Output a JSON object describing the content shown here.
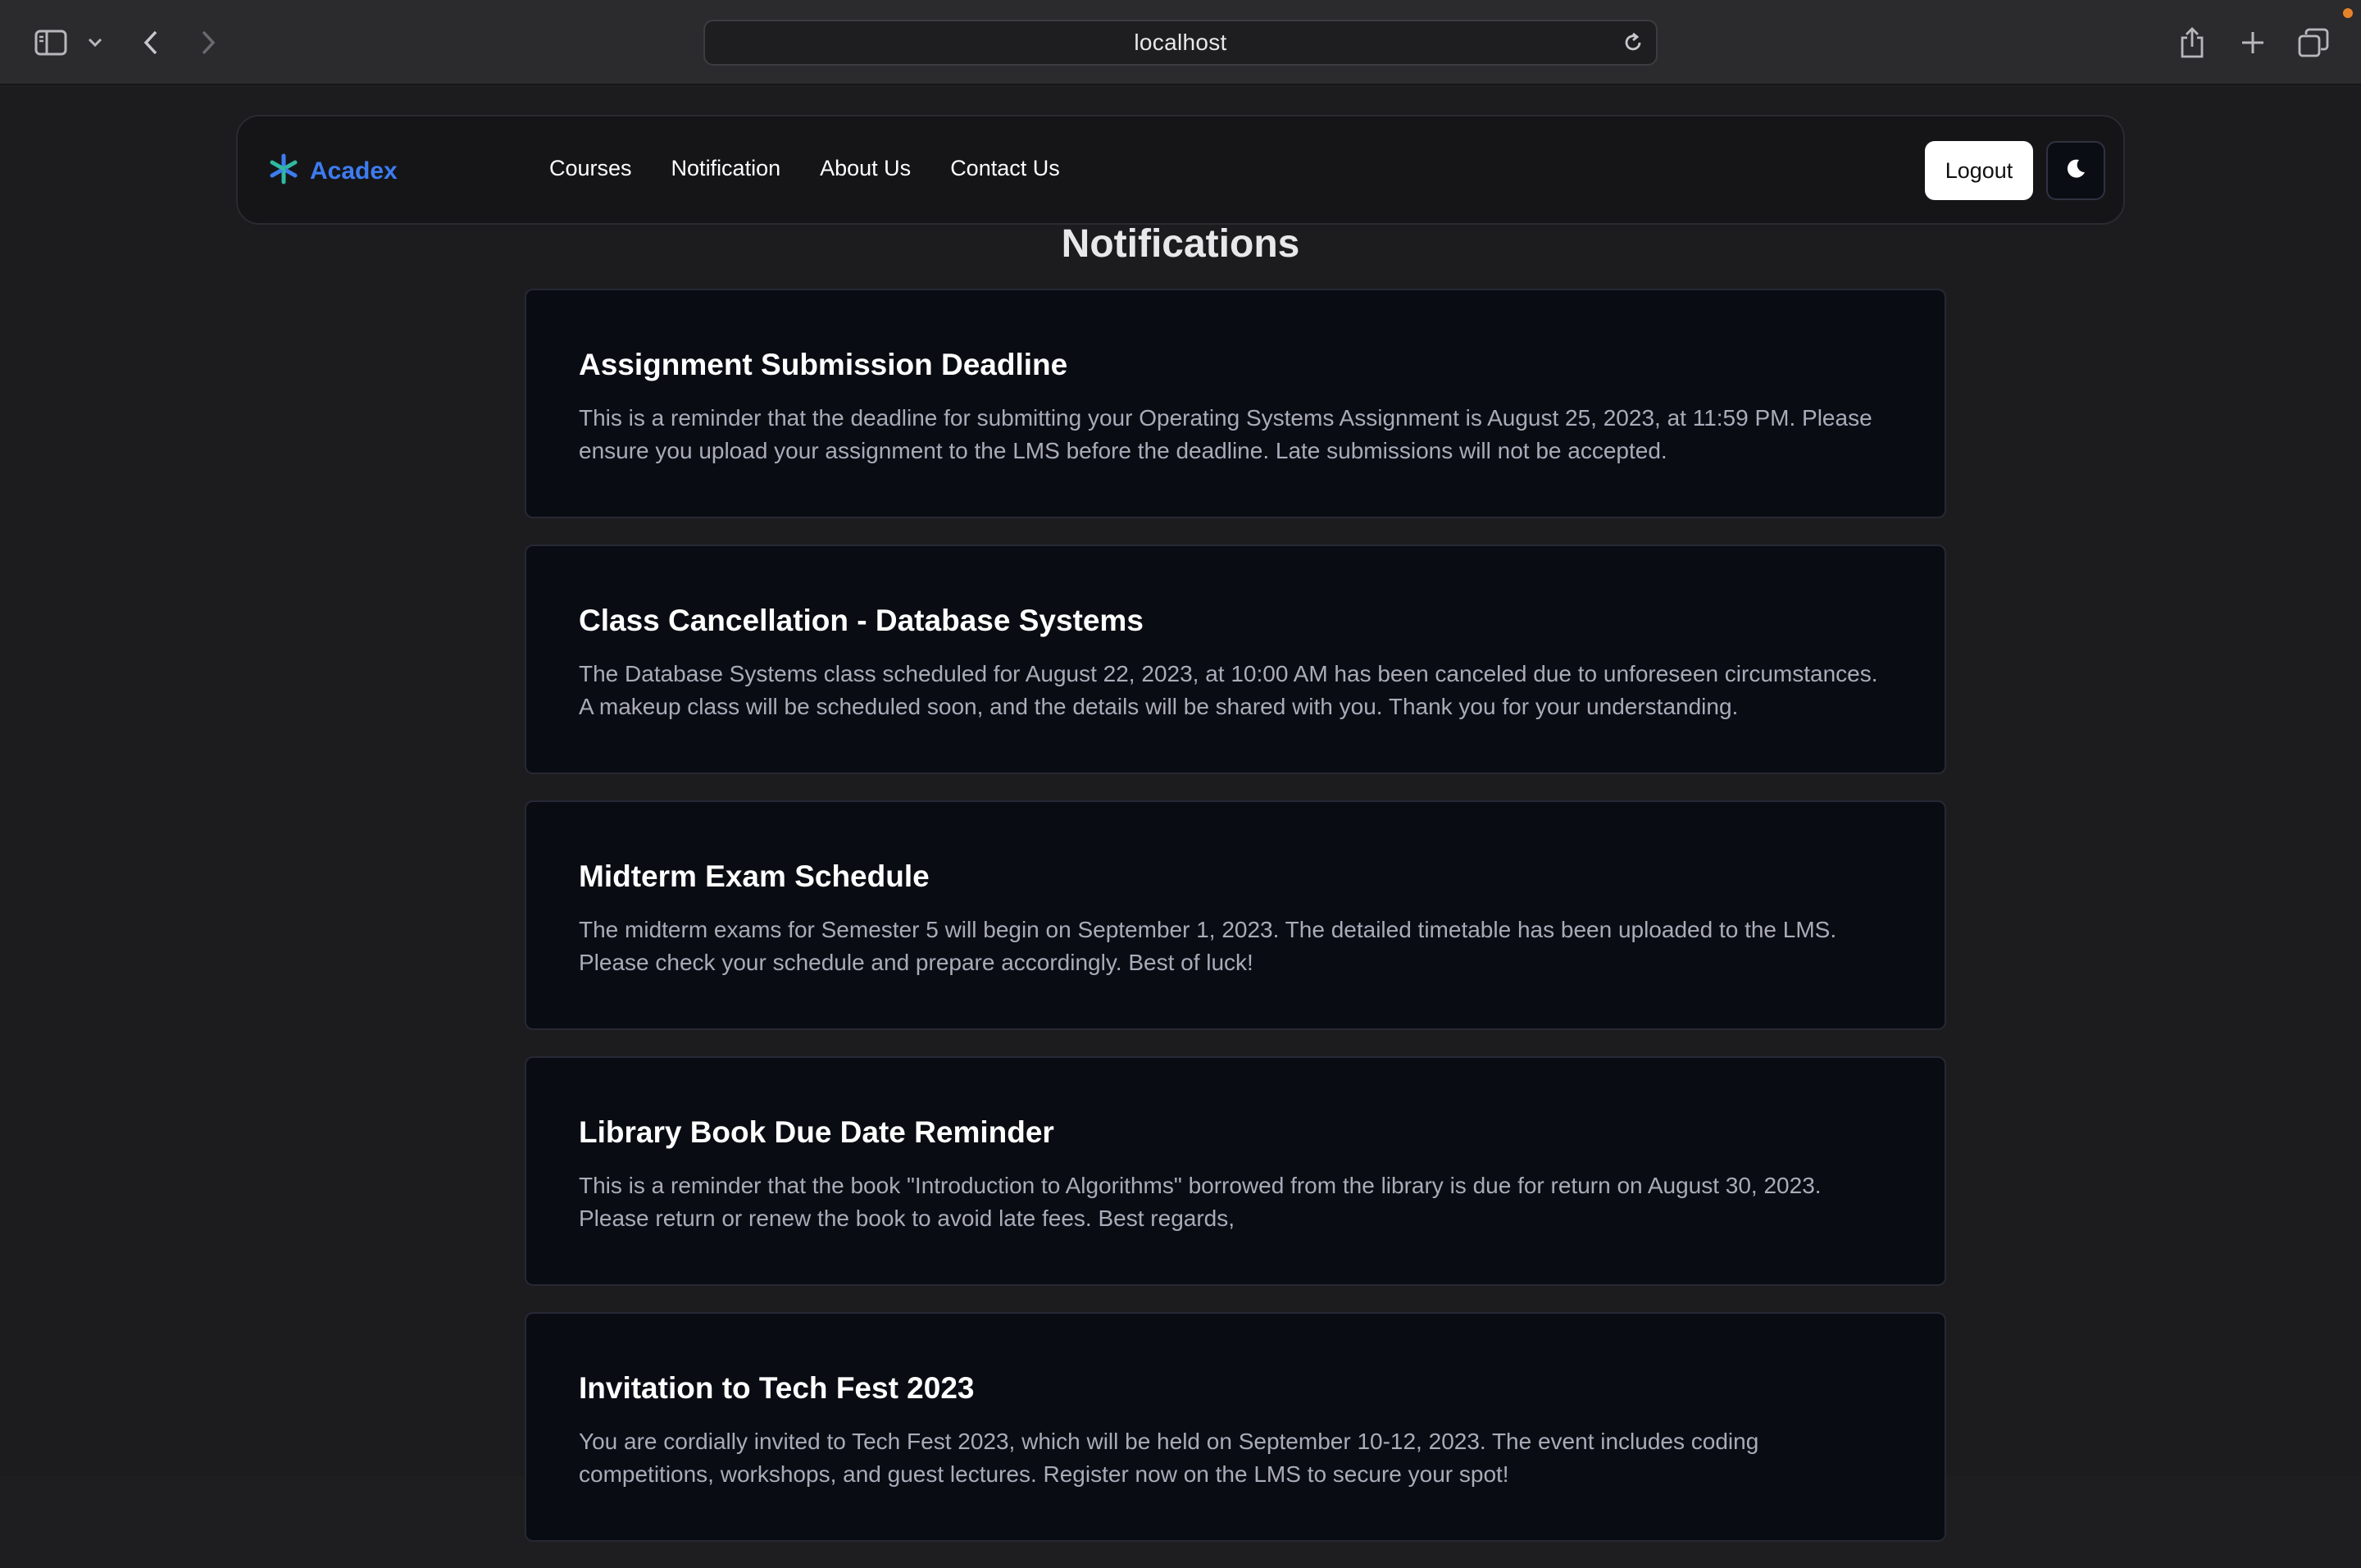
{
  "browser": {
    "url": "localhost"
  },
  "navbar": {
    "brand": "Acadex",
    "links": [
      "Courses",
      "Notification",
      "About Us",
      "Contact Us"
    ],
    "logout_label": "Logout"
  },
  "page": {
    "title": "Notifications"
  },
  "notifications": [
    {
      "title": "Assignment Submission Deadline",
      "body": "This is a reminder that the deadline for submitting your Operating Systems Assignment is August 25, 2023, at 11:59 PM. Please ensure you upload your assignment to the LMS before the deadline. Late submissions will not be accepted."
    },
    {
      "title": "Class Cancellation - Database Systems",
      "body": "The Database Systems class scheduled for August 22, 2023, at 10:00 AM has been canceled due to unforeseen circumstances. A makeup class will be scheduled soon, and the details will be shared with you. Thank you for your understanding."
    },
    {
      "title": "Midterm Exam Schedule",
      "body": "The midterm exams for Semester 5 will begin on September 1, 2023. The detailed timetable has been uploaded to the LMS. Please check your schedule and prepare accordingly. Best of luck!"
    },
    {
      "title": "Library Book Due Date Reminder",
      "body": "This is a reminder that the book \"Introduction to Algorithms\" borrowed from the library is due for return on August 30, 2023. Please return or renew the book to avoid late fees. Best regards,"
    },
    {
      "title": "Invitation to Tech Fest 2023",
      "body": "You are cordially invited to Tech Fest 2023, which will be held on September 10-12, 2023. The event includes coding competitions, workshops, and guest lectures. Register now on the LMS to secure your spot!"
    }
  ],
  "colors": {
    "brand": "#3d7cf0",
    "card_bg": "#0a0c13",
    "page_bg": "#1c1c1f"
  }
}
